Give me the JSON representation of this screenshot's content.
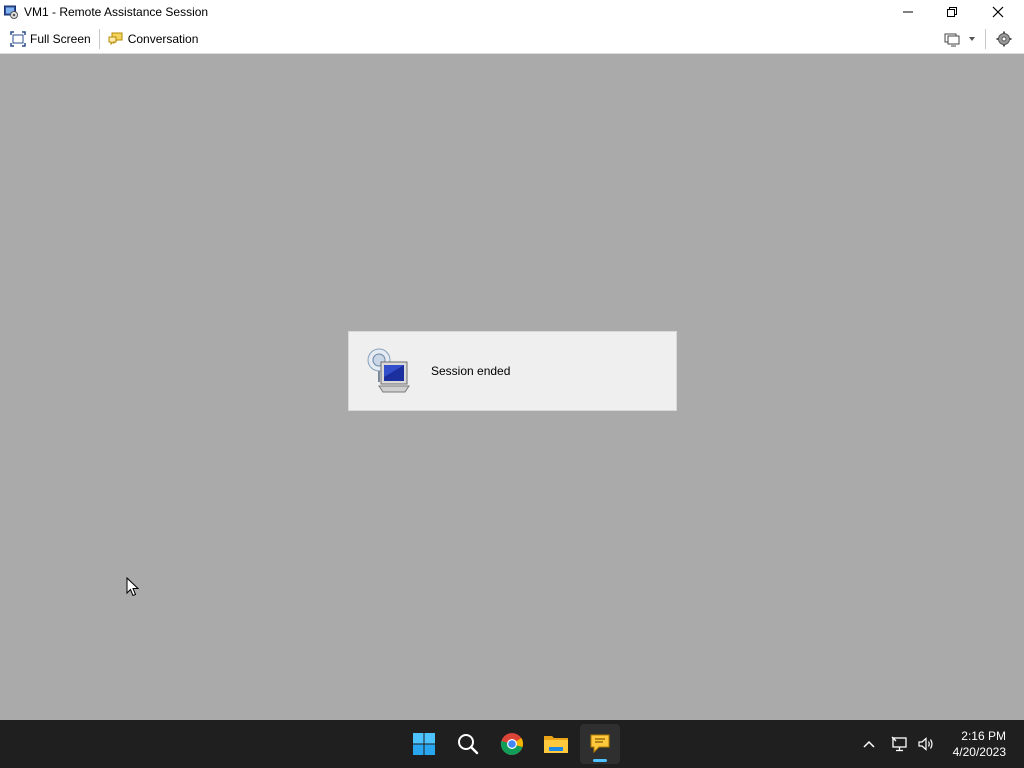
{
  "window": {
    "title": "VM1 - Remote Assistance Session",
    "icon": "remote-assistance-icon"
  },
  "toolbar": {
    "full_screen_label": "Full Screen",
    "conversation_label": "Conversation",
    "right_icons": [
      "display-icon",
      "chevron-down-icon",
      "settings-icon"
    ]
  },
  "session": {
    "message": "Session ended",
    "icon": "remote-assistance-computer-icon"
  },
  "taskbar": {
    "apps": [
      "start-icon",
      "search-icon",
      "chrome-icon",
      "file-explorer-icon",
      "remote-assistance-icon"
    ],
    "tray_icons": [
      "chevron-up-icon",
      "network-icon",
      "volume-icon"
    ],
    "time": "2:16 PM",
    "date": "4/20/2023"
  },
  "colors": {
    "remote_background": "#aaaaaa",
    "taskbar": "#1f1f1f",
    "accent": "#4cc2ff"
  }
}
